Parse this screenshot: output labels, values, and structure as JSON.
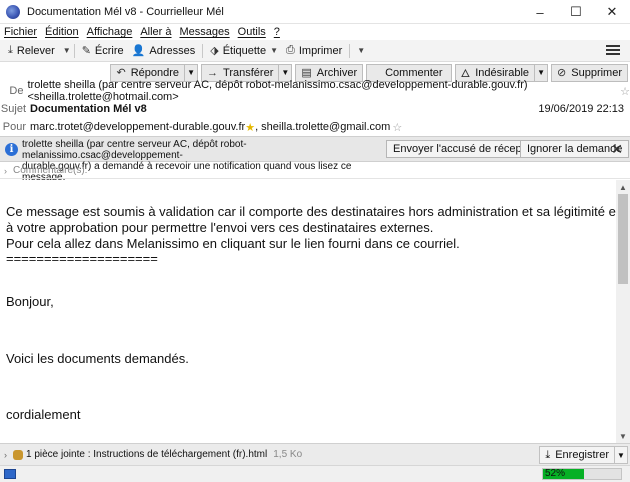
{
  "window": {
    "title": "Documentation Mél v8 - Courrielleur Mél",
    "minimize": "–",
    "maximize": "☐",
    "close": "✕"
  },
  "menu": [
    "Fichier",
    "Édition",
    "Affichage",
    "Aller à",
    "Messages",
    "Outils",
    "?"
  ],
  "toolbar": {
    "receive": "Relever",
    "write": "Écrire",
    "addresses": "Adresses",
    "tag": "Étiquette",
    "print": "Imprimer"
  },
  "actions": {
    "reply": "Répondre",
    "forward": "Transférer",
    "archive": "Archiver",
    "comment": "Commenter",
    "junk": "Indésirable",
    "delete": "Supprimer"
  },
  "header": {
    "from_label": "De",
    "from": "trolette sheilla (par centre serveur AC, dépôt robot-melanissimo.csac@developpement-durable.gouv.fr) <sheilla.trolette@hotmail.com>",
    "subject_label": "Sujet",
    "subject": "Documentation Mél v8",
    "date": "19/06/2019 22:13",
    "to_label": "Pour",
    "to_1": "marc.trotet@developpement-durable.gouv.fr",
    "to_2": ", sheilla.trolette@gmail.com"
  },
  "notification": {
    "icon": "i",
    "line_1": "trolette sheilla (par centre serveur AC, dépôt robot-melanissimo.csac@developpement-",
    "line_2": "durable.gouv.fr) a demandé à recevoir une notification quand vous lisez ce message.",
    "send_receipt": "Envoyer l'accusé de réception",
    "ignore": "Ignorer la demande",
    "close": "✕"
  },
  "comment_label": "Commentaire(s):",
  "body": [
    "Ce message est soumis à validation car il comporte des destinataires hors administration et sa légitimité est soumise",
    "à votre approbation pour permettre l'envoi vers ces destinataires externes.",
    "Pour cela allez dans Melanissimo en cliquant sur le lien fourni dans ce courriel.",
    "====================",
    "Bonjour,",
    "Voici les documents demandés.",
    "cordialement"
  ],
  "attachment": {
    "label": "1 pièce jointe : Instructions de téléchargement (fr).html",
    "size": "1,5 Ko",
    "save": "Enregistrer"
  },
  "status": {
    "progress_text": "52%",
    "progress": 0.52
  },
  "colors": {
    "progress": "#06b025",
    "info": "#2b6fd6"
  }
}
